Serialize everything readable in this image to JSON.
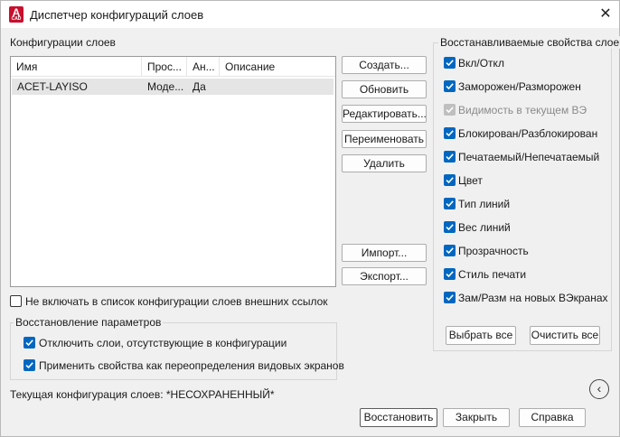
{
  "window": {
    "title": "Диспетчер конфигураций слоев",
    "app_icon_letter": "A",
    "app_icon_sub": "CAD"
  },
  "configs": {
    "label": "Конфигурации слоев",
    "columns": [
      "Имя",
      "Прос...",
      "Ан...",
      "Описание"
    ],
    "rows": [
      {
        "name": "ACET-LAYISO",
        "view": "Моде...",
        "annot": "Да",
        "desc": ""
      }
    ]
  },
  "actions": {
    "create": "Создать...",
    "update": "Обновить",
    "edit": "Редактировать...",
    "rename": "Переименовать",
    "delete": "Удалить",
    "import": "Импорт...",
    "export": "Экспорт..."
  },
  "exclude_xref": {
    "label": "Не включать в список конфигурации слоев внешних ссылок",
    "checked": false
  },
  "restore_options": {
    "title": "Восстановление параметров",
    "items": [
      {
        "label": "Отключить слои, отсутствующие в конфигурации",
        "checked": true
      },
      {
        "label": "Применить свойства как переопределения видовых экранов",
        "checked": true
      }
    ]
  },
  "current_config": {
    "label": "Текущая конфигурация слоев: *НЕСОХРАНЕННЫЙ*"
  },
  "properties": {
    "title": "Восстанавливаемые свойства слоев",
    "items": [
      {
        "label": "Вкл/Откл",
        "checked": true,
        "disabled": false
      },
      {
        "label": "Заморожен/Разморожен",
        "checked": true,
        "disabled": false
      },
      {
        "label": "Видимость в текущем ВЭ",
        "checked": true,
        "disabled": true
      },
      {
        "label": "Блокирован/Разблокирован",
        "checked": true,
        "disabled": false
      },
      {
        "label": "Печатаемый/Непечатаемый",
        "checked": true,
        "disabled": false
      },
      {
        "label": "Цвет",
        "checked": true,
        "disabled": false
      },
      {
        "label": "Тип линий",
        "checked": true,
        "disabled": false
      },
      {
        "label": "Вес линий",
        "checked": true,
        "disabled": false
      },
      {
        "label": "Прозрачность",
        "checked": true,
        "disabled": false
      },
      {
        "label": "Стиль печати",
        "checked": true,
        "disabled": false
      },
      {
        "label": "Зам/Разм на новых ВЭкранах",
        "checked": true,
        "disabled": false
      }
    ],
    "select_all": "Выбрать все",
    "clear_all": "Очистить все"
  },
  "footer": {
    "restore": "Восстановить",
    "close": "Закрыть",
    "help": "Справка"
  },
  "icons": {
    "close": "close-icon",
    "collapse": "chevron-left-icon"
  },
  "colors": {
    "accent": "#0067c0",
    "app_icon": "#c8102e"
  }
}
